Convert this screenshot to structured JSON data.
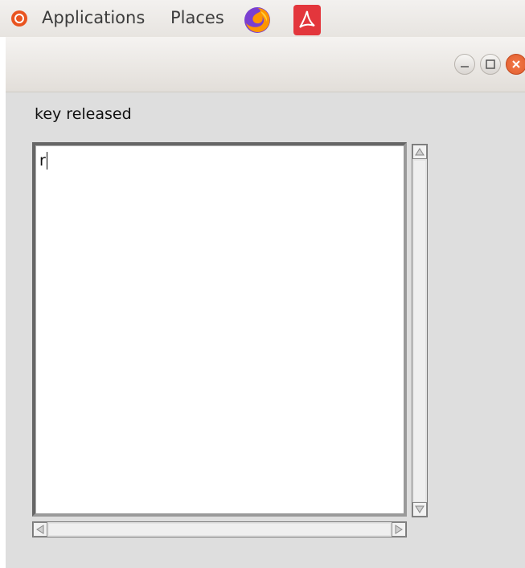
{
  "panel": {
    "applications_label": "Applications",
    "places_label": "Places",
    "icons": [
      "ubuntu-logo-icon",
      "firefox-icon",
      "pdf-icon"
    ]
  },
  "window": {
    "buttons": [
      "minimize",
      "maximize",
      "close"
    ]
  },
  "content": {
    "status_label": "key released",
    "textarea_value": "r"
  },
  "colors": {
    "accent": "#e95420",
    "close_button": "#e05d2d",
    "background": "#dedede"
  }
}
